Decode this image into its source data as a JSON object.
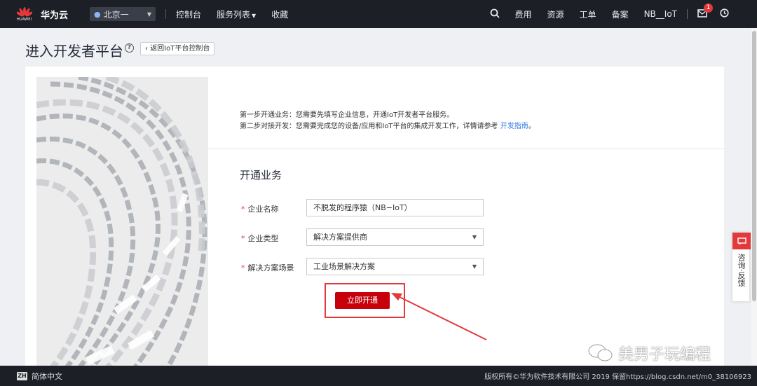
{
  "topbar": {
    "brand": "华为云",
    "brand_small": "HUAWEI",
    "region": "北京一",
    "nav": [
      "控制台",
      "服务列表",
      "收藏"
    ],
    "right": [
      "费用",
      "资源",
      "工单",
      "备案",
      "NB__IoT"
    ],
    "mail_badge": "1"
  },
  "header": {
    "title": "进入开发者平台",
    "back_button": "返回IoT平台控制台"
  },
  "intro": {
    "step1": "第一步开通业务：您需要先填写企业信息，开通IoT开发者平台服务。",
    "step2_prefix": "第二步对接开发：您需要完成您的设备/应用和IoT平台的集成开发工作，详情请参考 ",
    "step2_link": "开发指南",
    "step2_suffix": "。"
  },
  "form": {
    "section_title": "开通业务",
    "fields": [
      {
        "label": "企业名称",
        "value": "不脱发的程序猿（NB−IoT）"
      },
      {
        "label": "企业类型",
        "value": "解决方案提供商"
      },
      {
        "label": "解决方案场景",
        "value": "工业场景解决方案"
      }
    ],
    "submit": "立即开通"
  },
  "float_panel": {
    "label": "咨询·反馈"
  },
  "watermark": "美男子玩编程",
  "footer": {
    "lang_icon": "ZH",
    "language": "简体中文",
    "copyright": "版权所有©华为软件技术有限公司 2019 保留https://blog.csdn.net/m0_38106923"
  },
  "colors": {
    "accent": "#c7000b",
    "nav_bg": "#1c1f26",
    "link": "#2f7ae5",
    "annotation": "#e4393c"
  }
}
